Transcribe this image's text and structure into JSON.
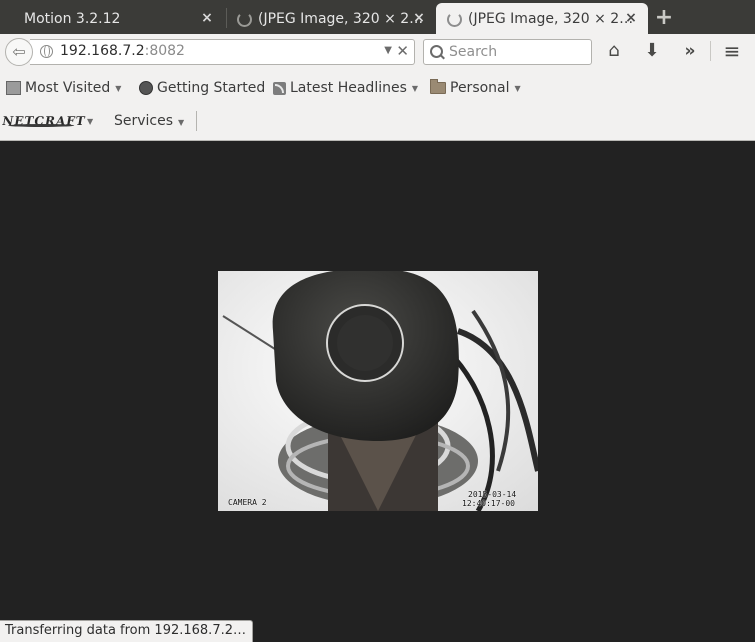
{
  "tabs": [
    {
      "title": "Motion 3.2.12",
      "active": false,
      "loading": false
    },
    {
      "title": "(JPEG Image, 320 × 2…",
      "active": false,
      "loading": true
    },
    {
      "title": "(JPEG Image, 320 × 2…",
      "active": true,
      "loading": true
    }
  ],
  "urlbar": {
    "host": "192.168.7.2",
    "port": ":8082"
  },
  "search": {
    "placeholder": "Search"
  },
  "bookmarks": [
    {
      "label": "Most Visited",
      "icon": "most-visited-icon",
      "dropdown": true
    },
    {
      "label": "Getting Started",
      "icon": "firefox-icon",
      "dropdown": false
    },
    {
      "label": "Latest Headlines",
      "icon": "rss-icon",
      "dropdown": true
    },
    {
      "label": "Personal",
      "icon": "folder-icon",
      "dropdown": true
    }
  ],
  "netcraft": {
    "logo_text": "NETCRAFT",
    "services_label": "Services"
  },
  "image": {
    "camera_label": "CAMERA 2",
    "date": "2015-03-14",
    "time": "12:40:17-00"
  },
  "status": "Transferring data from 192.168.7.2…",
  "colors": {
    "chrome_bg": "#f2f1f0",
    "tabstrip_bg": "#3b3b38",
    "content_bg": "#222222"
  }
}
